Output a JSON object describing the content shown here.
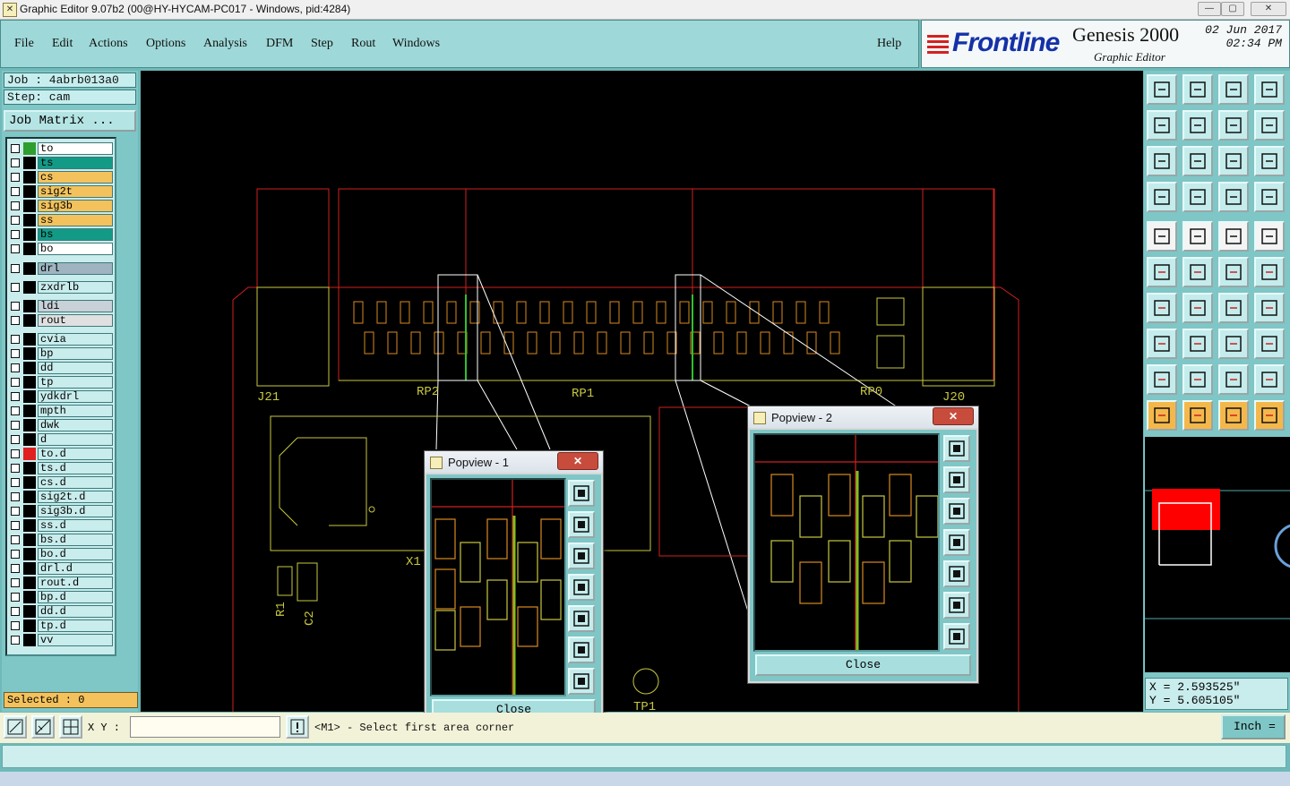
{
  "window": {
    "title": "Graphic Editor 9.07b2 (00@HY-HYCAM-PC017 - Windows, pid:4284)",
    "min_label": "—",
    "max_label": "▢",
    "close_label": "✕"
  },
  "menu": {
    "items": [
      "File",
      "Edit",
      "Actions",
      "Options",
      "Analysis",
      "DFM",
      "Step",
      "Rout",
      "Windows"
    ],
    "help": "Help"
  },
  "branding": {
    "logo": "Frontline",
    "product": "Genesis 2000",
    "subtitle": "Graphic Editor",
    "date": "02 Jun 2017",
    "time": "02:34 PM"
  },
  "job": {
    "job_label": "Job : 4abrb013a0",
    "step_label": "Step: cam",
    "matrix_button": "Job Matrix ..."
  },
  "layers": [
    {
      "name": "to",
      "color": "#ffffff",
      "swatch": "#2f9e2f"
    },
    {
      "name": "ts",
      "color": "#139a86",
      "swatch": "#000000"
    },
    {
      "name": "cs",
      "color": "#f4c25c",
      "swatch": "#000000"
    },
    {
      "name": "sig2t",
      "color": "#f4c25c",
      "swatch": "#000000"
    },
    {
      "name": "sig3b",
      "color": "#f4c25c",
      "swatch": "#000000"
    },
    {
      "name": "ss",
      "color": "#f4c25c",
      "swatch": "#000000"
    },
    {
      "name": "bs",
      "color": "#139a86",
      "swatch": "#000000"
    },
    {
      "name": "bo",
      "color": "#ffffff",
      "swatch": "#000000"
    },
    {
      "name": "drl",
      "color": "#9fb4c0",
      "swatch": "#000000"
    },
    {
      "name": "zxdrlb",
      "color": "#c9ecec",
      "swatch": "#000000"
    },
    {
      "name": "ldi",
      "color": "#c8d0d8",
      "swatch": "#000000"
    },
    {
      "name": "rout",
      "color": "#e0e0e0",
      "swatch": "#000000"
    },
    {
      "name": "cvia",
      "color": "#c9ecec",
      "swatch": "#000000"
    },
    {
      "name": "bp",
      "color": "#c9ecec",
      "swatch": "#000000"
    },
    {
      "name": "dd",
      "color": "#c9ecec",
      "swatch": "#000000"
    },
    {
      "name": "tp",
      "color": "#c9ecec",
      "swatch": "#000000"
    },
    {
      "name": "ydkdrl",
      "color": "#c9ecec",
      "swatch": "#000000"
    },
    {
      "name": "mpth",
      "color": "#c9ecec",
      "swatch": "#000000"
    },
    {
      "name": "dwk",
      "color": "#c9ecec",
      "swatch": "#000000"
    },
    {
      "name": "d",
      "color": "#c9ecec",
      "swatch": "#000000"
    },
    {
      "name": "to.d",
      "color": "#c9ecec",
      "swatch": "#e02020"
    },
    {
      "name": "ts.d",
      "color": "#c9ecec",
      "swatch": "#000000"
    },
    {
      "name": "cs.d",
      "color": "#c9ecec",
      "swatch": "#000000"
    },
    {
      "name": "sig2t.d",
      "color": "#c9ecec",
      "swatch": "#000000"
    },
    {
      "name": "sig3b.d",
      "color": "#c9ecec",
      "swatch": "#000000"
    },
    {
      "name": "ss.d",
      "color": "#c9ecec",
      "swatch": "#000000"
    },
    {
      "name": "bs.d",
      "color": "#c9ecec",
      "swatch": "#000000"
    },
    {
      "name": "bo.d",
      "color": "#c9ecec",
      "swatch": "#000000"
    },
    {
      "name": "drl.d",
      "color": "#c9ecec",
      "swatch": "#000000"
    },
    {
      "name": "rout.d",
      "color": "#c9ecec",
      "swatch": "#000000"
    },
    {
      "name": "bp.d",
      "color": "#c9ecec",
      "swatch": "#000000"
    },
    {
      "name": "dd.d",
      "color": "#c9ecec",
      "swatch": "#000000"
    },
    {
      "name": "tp.d",
      "color": "#c9ecec",
      "swatch": "#000000"
    },
    {
      "name": "vv",
      "color": "#c9ecec",
      "swatch": "#000000"
    }
  ],
  "selected": "Selected : 0",
  "board_labels": {
    "j21": "J21",
    "rp2": "RP2",
    "rp1": "RP1",
    "rp0": "RP0",
    "j20": "J20",
    "x1": "X1",
    "r1": "R1",
    "c2": "C2",
    "tp1": "TP1"
  },
  "popview1": {
    "title": "Popview - 1",
    "close_x": "✕",
    "close_button": "Close"
  },
  "popview2": {
    "title": "Popview - 2",
    "close_x": "✕",
    "close_button": "Close"
  },
  "coords": {
    "x": "X = 2.593525\"",
    "y": "Y = 5.605105\""
  },
  "bottom": {
    "xy_label": "X Y :",
    "prompt": "<M1> - Select first area corner",
    "units": "Inch ="
  }
}
